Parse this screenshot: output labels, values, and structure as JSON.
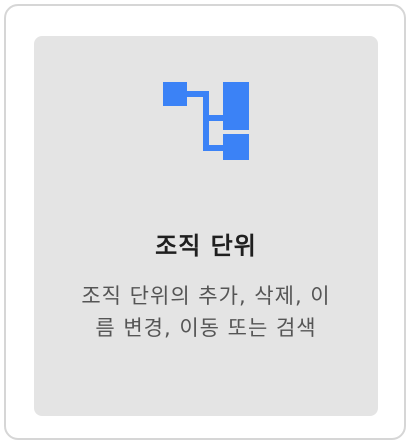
{
  "card": {
    "icon": "org-unit-icon",
    "accent_color": "#3b82f6",
    "title": "조직 단위",
    "description": "조직 단위의 추가, 삭제, 이름 변경, 이동 또는 검색"
  }
}
